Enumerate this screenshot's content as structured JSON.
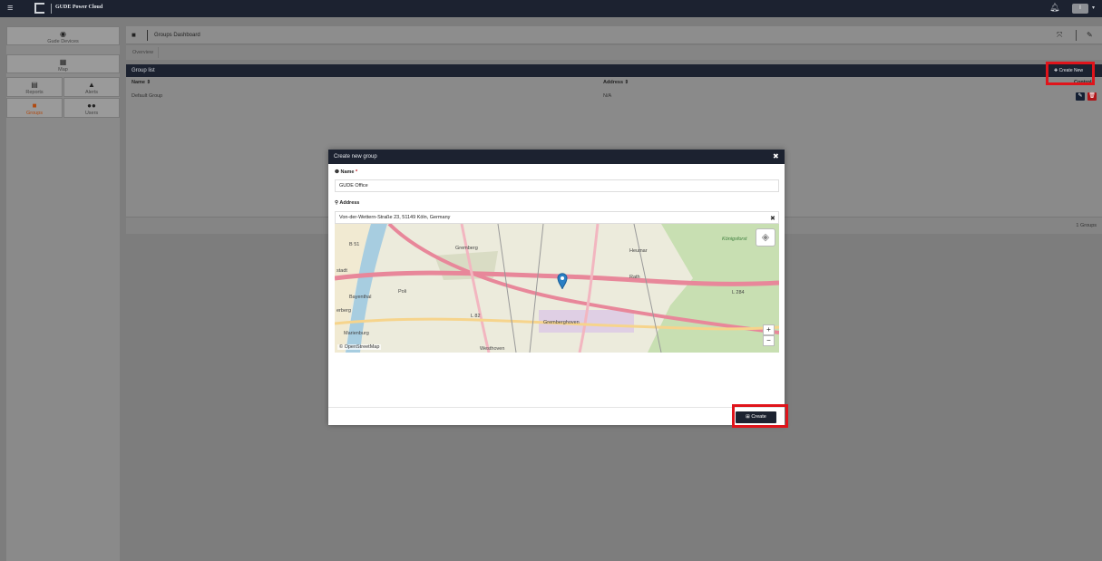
{
  "topbar": {
    "brand": "GUDE Power Cloud",
    "user_initial": "I"
  },
  "sidebar": {
    "items": [
      {
        "label": "Gude Devices"
      },
      {
        "label": "Map"
      },
      {
        "label": "Reports"
      },
      {
        "label": "Alerts"
      },
      {
        "label": "Groups"
      },
      {
        "label": "Users"
      }
    ]
  },
  "header": {
    "title": "Groups Dashboard",
    "tab": "Overview"
  },
  "group_list": {
    "title": "Group list",
    "create_new_label": "Create New",
    "columns": [
      "Name ⇕",
      "Address ⇕",
      "Controls"
    ],
    "rows": [
      {
        "name": "Default Group",
        "address": "N/A"
      }
    ],
    "footer_count": "1 Groups"
  },
  "modal": {
    "title": "Create new group",
    "name_label": "Name",
    "name_required_mark": "*",
    "name_value": "GUDE Office",
    "address_label": "Address",
    "address_value": "Von-der-Wettern-Straße 23, 51149 Köln, Germany",
    "map_attribution": "© OpenStreetMap",
    "map_labels": [
      "Gremberg",
      "Poli",
      "Bayenthal",
      "Marienburg",
      "Westhoven",
      "Rath",
      "Heumar",
      "Königsforst",
      "Gremberghoven",
      "L 284",
      "L 82",
      "B 51",
      "stadt",
      "erberg"
    ],
    "zoom_in": "+",
    "zoom_out": "−",
    "create_label": "Create"
  }
}
